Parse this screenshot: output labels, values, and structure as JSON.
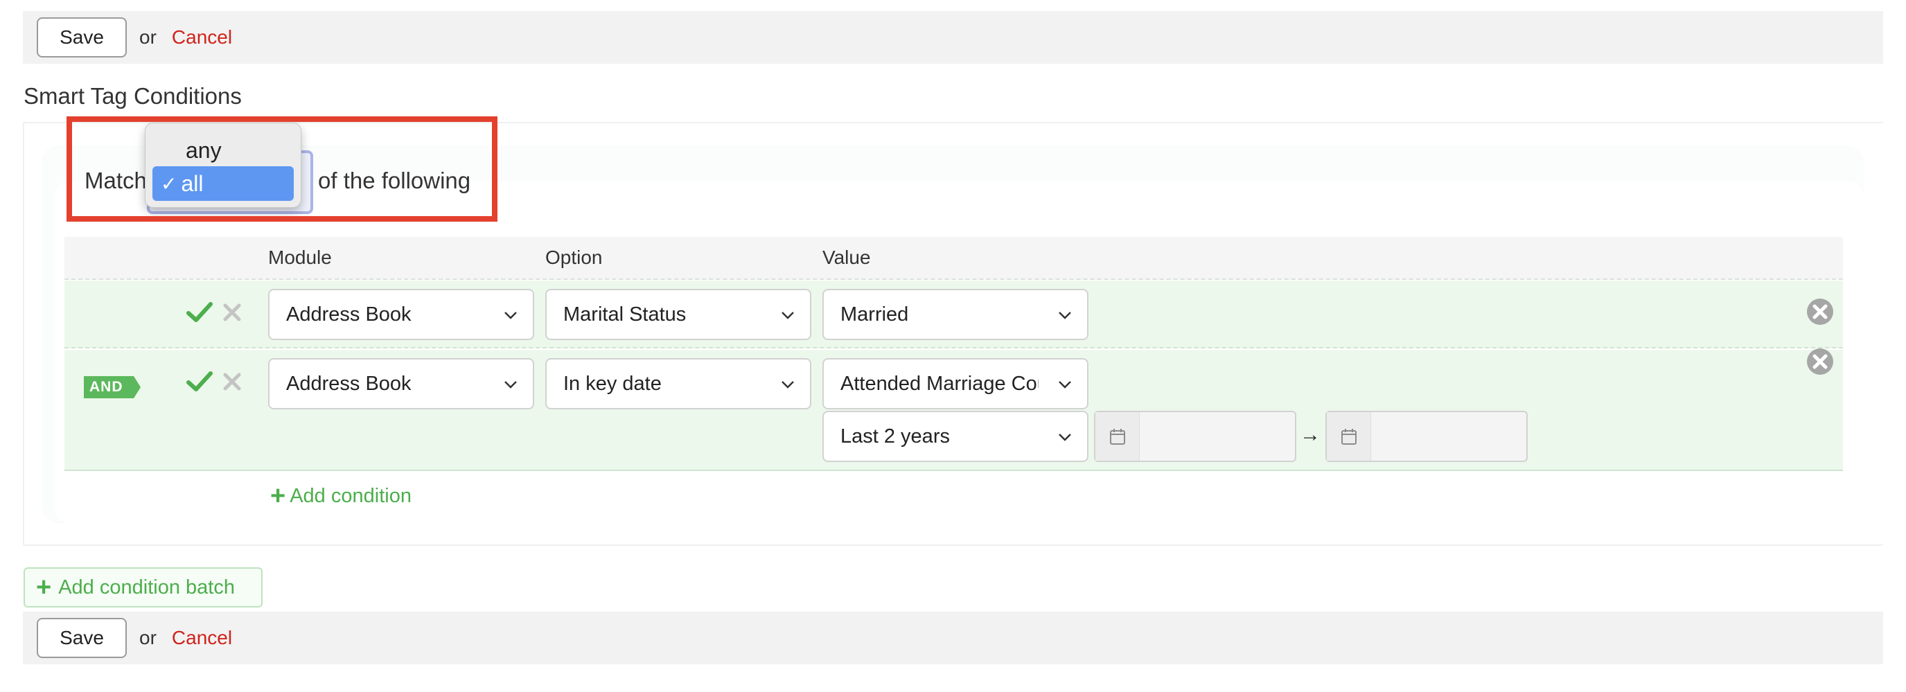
{
  "top_bar": {
    "save_label": "Save",
    "or_label": "or",
    "cancel_label": "Cancel"
  },
  "section": {
    "title": "Smart Tag Conditions"
  },
  "match": {
    "prefix": "Match",
    "suffix": "of the following",
    "dropdown_options": [
      "any",
      "all"
    ],
    "selected": "all",
    "check_glyph": "✓"
  },
  "table": {
    "headers": {
      "module": "Module",
      "option": "Option",
      "value": "Value"
    },
    "rows": [
      {
        "module": "Address Book",
        "option": "Marital Status",
        "value": "Married"
      },
      {
        "connector": "AND",
        "module": "Address Book",
        "option": "In key date",
        "value": "Attended Marriage Course",
        "range": "Last 2 years",
        "range_arrow": "→",
        "date_from": "",
        "date_to": ""
      }
    ],
    "add_condition_label": "Add condition"
  },
  "add_batch_label": "Add condition batch",
  "bottom_bar": {
    "save_label": "Save",
    "or_label": "or",
    "cancel_label": "Cancel"
  },
  "icons": {
    "check": "check-icon",
    "times": "times-icon",
    "remove": "remove-circle-icon",
    "calendar": "calendar-icon",
    "chevron": "chevron-down-icon",
    "plus": "plus-icon"
  },
  "colors": {
    "cancel": "#d0231c",
    "green": "#4cae4c",
    "row_bg": "#ecf8ec",
    "highlight": "#e4402e",
    "selected_option": "#5e97f2"
  }
}
